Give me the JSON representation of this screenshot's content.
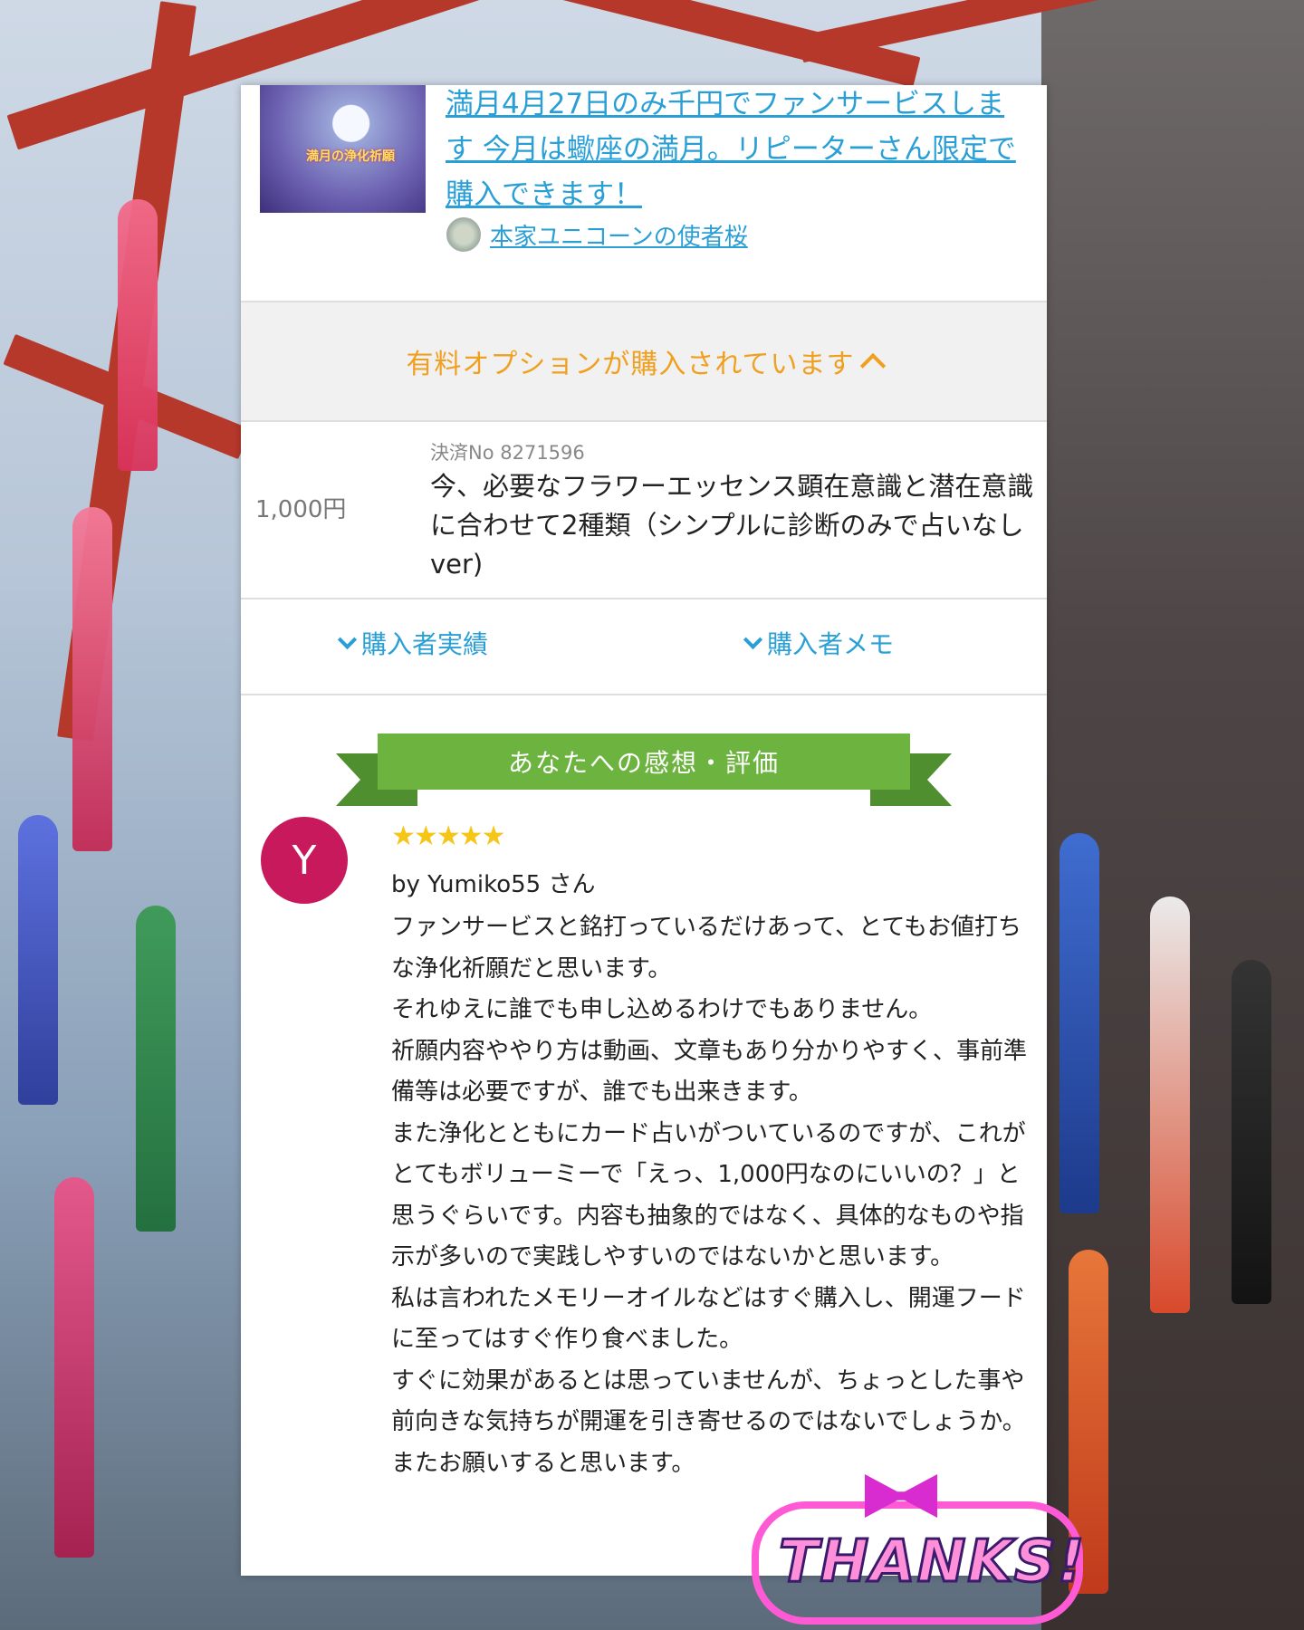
{
  "product": {
    "thumbnail_caption": "満月の浄化祈願",
    "title": "満月4月27日のみ千円でファンサービスします 今月は蠍座の満月。リピーターさん限定で購入できます！",
    "seller_name": "本家ユニコーンの使者桜"
  },
  "option_bar": {
    "label": "有料オプションが購入されています"
  },
  "payment": {
    "price": "1,000円",
    "number": "決済No 8271596",
    "description": "今、必要なフラワーエッセンス顕在意識と潜在意識に合わせて2種類（シンプルに診断のみで占いなしver)"
  },
  "buyer_links": {
    "history": "購入者実績",
    "memo": "購入者メモ"
  },
  "review_section": {
    "ribbon": "あなたへの感想・評価",
    "avatar_letter": "Y",
    "stars": "★★★★★",
    "rating": 5,
    "reviewer": "by Yumiko55 さん",
    "text": "ファンサービスと銘打っているだけあって、とてもお値打ちな浄化祈願だと思います。\nそれゆえに誰でも申し込めるわけでもありません。\n祈願内容ややり方は動画、文章もあり分かりやすく、事前準備等は必要ですが、誰でも出来きます。\nまた浄化とともにカード占いがついているのですが、これがとてもボリューミーで「えっ、1,000円なのにいいの？」と思うぐらいです。内容も抽象的ではなく、具体的なものや指示が多いので実践しやすいのではないかと思います。\n私は言われたメモリーオイルなどはすぐ購入し、開運フードに至ってはすぐ作り食べました。\nすぐに効果があるとは思っていませんが、ちょっとした事や前向きな気持ちが開運を引き寄せるのではないでしょうか。\nまたお願いすると思います。"
  },
  "sticker": {
    "text": "THANKS!"
  },
  "colors": {
    "link": "#2a9fd6",
    "option_accent": "#f0a020",
    "ribbon_green": "#6db33f",
    "avatar_magenta": "#c8195c",
    "star_gold": "#f5c518"
  }
}
